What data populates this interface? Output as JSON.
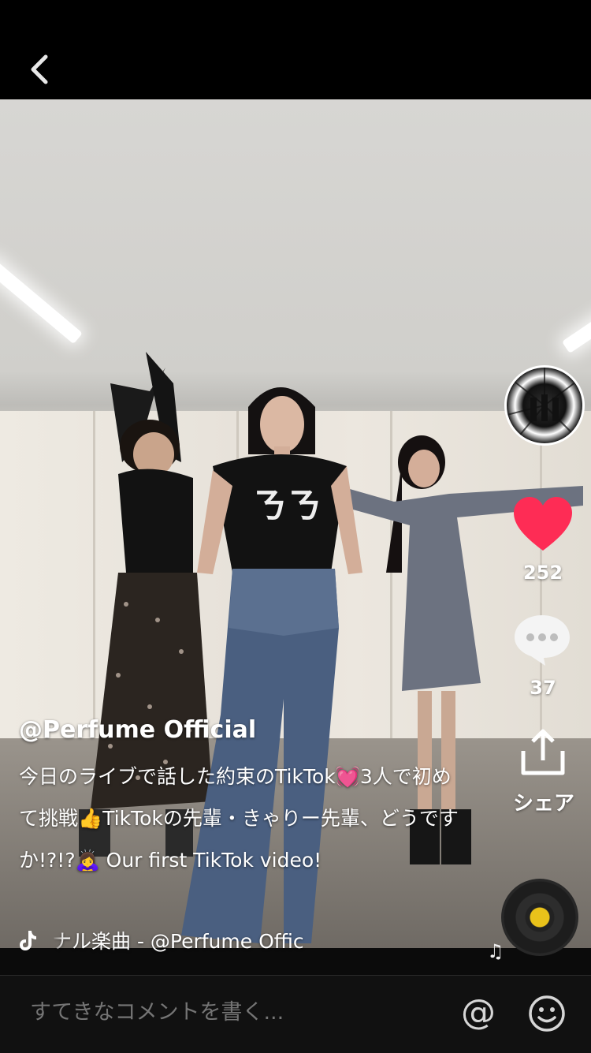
{
  "header": {
    "back_label": ""
  },
  "post": {
    "username": "@Perfume Official",
    "caption": "今日のライブで話した約束のTikTok💓3人で初めて挑戦👍TikTokの先輩・きゃりー先輩、どうですか!?!?🙇‍♀️ Our first TikTok video!",
    "music": "ナル楽曲 - @Perfume Offic"
  },
  "actions": {
    "likes": "252",
    "comments": "37",
    "share_label": "シェア"
  },
  "comment_bar": {
    "placeholder": "すてきなコメントを書く...",
    "mention_icon": "@"
  },
  "colors": {
    "like": "#fe2c55",
    "disc_center": "#e9c21a"
  },
  "icons": [
    "back-icon",
    "heart-icon",
    "comment-icon",
    "share-icon",
    "music-disc-icon",
    "music-note-icon",
    "at-icon",
    "emoji-icon"
  ]
}
